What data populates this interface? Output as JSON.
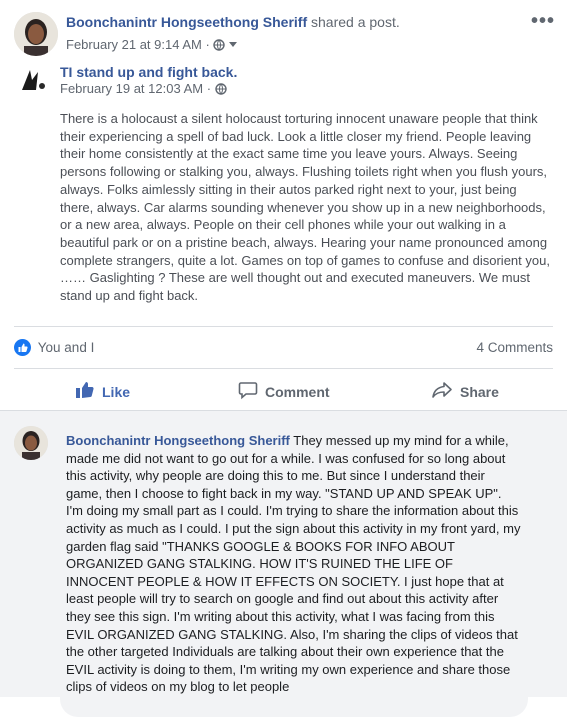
{
  "share": {
    "author": "Boonchanintr Hongseethong Sheriff",
    "action": "shared a post.",
    "time": "February 21 at 9:14 AM",
    "dot": "·",
    "audience_icon": "globe-icon",
    "more_label": "•••"
  },
  "original": {
    "title": "TI stand up and fight back.",
    "time": "February 19 at 12:03 AM",
    "dot": "·",
    "audience_icon": "globe-icon",
    "body": "There is a holocaust a silent holocaust torturing innocent unaware people that think their experiencing a spell of bad luck. Look a little closer my friend. People leaving their home consistently at the exact same time you leave yours. Always. Seeing persons following or stalking you, always. Flushing toilets right when you flush yours, always. Folks aimlessly sitting in their autos parked right next to your, just being there, always. Car alarms sounding whenever you show up in a new neighborhoods, or a new area, always. People on their cell phones while your out walking in a beautiful park or on a pristine beach, always. Hearing your name pronounced among complete strangers, quite a lot. Games on top of games to confuse and disorient you, …… Gaslighting ? These are well thought out and executed maneuvers. We must stand up and fight back."
  },
  "reactions": {
    "summary": "You and I",
    "comments_count": "4 Comments"
  },
  "actions": {
    "like": "Like",
    "comment": "Comment",
    "share": "Share"
  },
  "comment": {
    "author": "Boonchanintr Hongseethong Sheriff",
    "text": "They messed up my mind for a while, made me did not want to go out for a while. I was confused for so long about this activity, why people are doing this to me. But since I understand their game, then I choose to fight back in my way. \"STAND UP AND SPEAK UP\". I'm doing my small part as I could. I'm trying to share the information about this activity as much as I could. I put the sign about this activity in my front yard, my garden flag said \"THANKS GOOGLE & BOOKS FOR INFO ABOUT ORGANIZED GANG STALKING. HOW IT'S RUINED THE LIFE OF INNOCENT PEOPLE & HOW IT EFFECTS ON SOCIETY. I just hope that at least people will try to search on google and find out about this activity after they see this sign. I'm writing about this activity, what I was facing from this EVIL ORGANIZED GANG STALKING. Also, I'm sharing the clips of videos that the other targeted Individuals are talking about their own experience that the EVIL activity is doing to them, I'm writing my own experience and share those clips of videos on my blog to let people"
  },
  "colors": {
    "link": "#385898",
    "like_blue": "#4267b2",
    "badge_blue": "#1877f2",
    "comment_bg": "#f2f3f5"
  }
}
